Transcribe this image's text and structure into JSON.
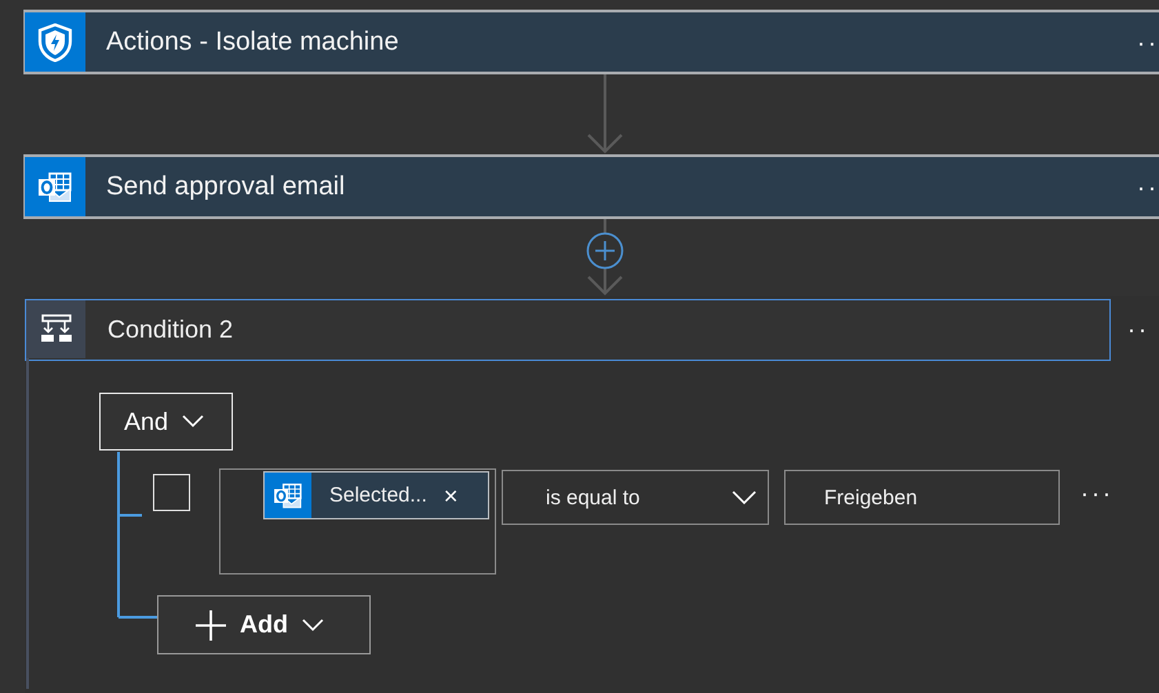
{
  "steps": [
    {
      "kind": "action",
      "title": "Actions - Isolate machine",
      "more": "··"
    },
    {
      "kind": "action",
      "title": "Send approval email",
      "more": "··"
    },
    {
      "kind": "condition",
      "title": "Condition 2",
      "more": "··",
      "group": {
        "operator": "And",
        "rows": [
          {
            "checked": false,
            "token": {
              "label": "Selected...",
              "remove": "×"
            },
            "comparison": "is equal to",
            "value": "Freigeben",
            "more": "···"
          }
        ],
        "add": "Add"
      }
    }
  ],
  "connectors": [
    {
      "plus": false
    },
    {
      "plus": true
    }
  ]
}
